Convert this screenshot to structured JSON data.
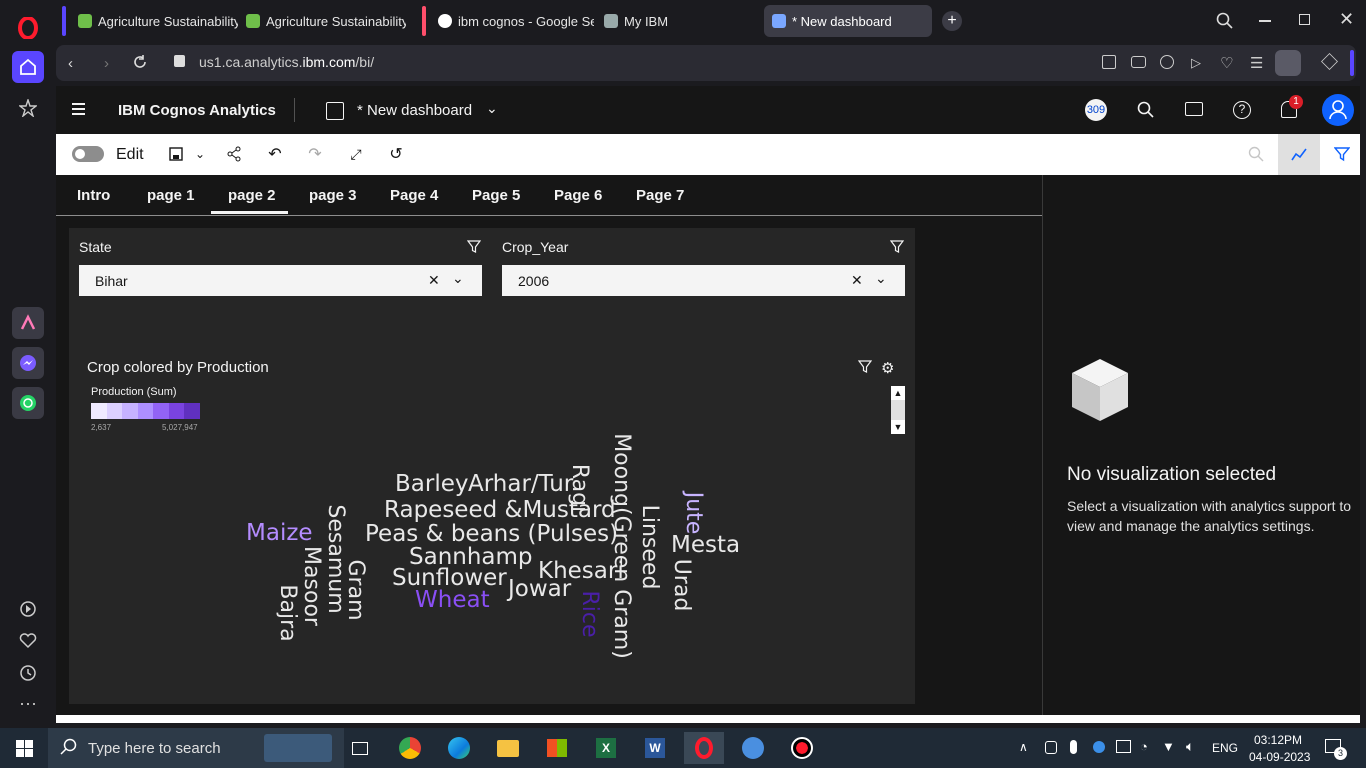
{
  "browser": {
    "tabs": [
      {
        "label": "Agriculture Sustainability",
        "color": "#6fbf4a"
      },
      {
        "label": "Agriculture Sustainability",
        "color": "#6fbf4a"
      },
      {
        "label": "ibm cognos - Google Sear",
        "color": "#e0e0e0"
      },
      {
        "label": "My IBM",
        "color": "#e0e0e0"
      },
      {
        "label": "* New dashboard",
        "color": "#7aa7ff"
      }
    ],
    "url_prefix": "us1.ca.analytics.",
    "url_domain": "ibm.com",
    "url_path": "/bi/"
  },
  "app": {
    "name": "IBM Cognos Analytics",
    "dashboard_title": "* New dashboard",
    "notification_count": "1",
    "badge_number": "309"
  },
  "toolbar": {
    "edit_label": "Edit"
  },
  "pages": [
    "Intro",
    "page 1",
    "page 2",
    "page 3",
    "Page 4",
    "Page 5",
    "Page 6",
    "Page 7"
  ],
  "filters": [
    {
      "label": "State",
      "value": "Bihar"
    },
    {
      "label": "Crop_Year",
      "value": "2006"
    }
  ],
  "visualization": {
    "title": "Crop colored by Production",
    "legend_title": "Production (Sum)",
    "legend_min": "2,637",
    "legend_max": "5,027,947",
    "legend_colors": [
      "#f0ebff",
      "#dcd0ff",
      "#c6b2ff",
      "#ad8fff",
      "#9263f5",
      "#7a43e0",
      "#6030c0"
    ],
    "words": [
      {
        "text": "Barley",
        "color": "#e8e8e8"
      },
      {
        "text": "Arhar/Tur",
        "color": "#e8e8e8"
      },
      {
        "text": "Rapeseed &Mustard",
        "color": "#e8e8e8"
      },
      {
        "text": "Peas & beans (Pulses)",
        "color": "#e8e8e8"
      },
      {
        "text": "Sannhamp",
        "color": "#e8e8e8"
      },
      {
        "text": "Sunflower",
        "color": "#e8e8e8"
      },
      {
        "text": "Wheat",
        "color": "#8a4ff5"
      },
      {
        "text": "Jowar",
        "color": "#e8e8e8"
      },
      {
        "text": "Khesari",
        "color": "#e8e8e8"
      },
      {
        "text": "Maize",
        "color": "#b48cff"
      },
      {
        "text": "Mesta",
        "color": "#e8e8e8"
      },
      {
        "text": "Bajra",
        "color": "#e8e8e8"
      },
      {
        "text": "Masoor",
        "color": "#e8e8e8"
      },
      {
        "text": "Sesamum",
        "color": "#e8e8e8"
      },
      {
        "text": "Gram",
        "color": "#e8e8e8"
      },
      {
        "text": "Ragi",
        "color": "#e8e8e8"
      },
      {
        "text": "Rice",
        "color": "#4a1fa8"
      },
      {
        "text": "Moong(Green Gram)",
        "color": "#e8e8e8"
      },
      {
        "text": "Linseed",
        "color": "#e8e8e8"
      },
      {
        "text": "Urad",
        "color": "#e8e8e8"
      },
      {
        "text": "Jute",
        "color": "#c8b4ff"
      }
    ]
  },
  "right_panel": {
    "title": "No visualization selected",
    "description": "Select a visualization with analytics support to view and manage the analytics settings."
  },
  "taskbar": {
    "search_placeholder": "Type here to search",
    "language": "ENG",
    "time": "03:12PM",
    "date": "04-09-2023",
    "notification_count": "3"
  }
}
